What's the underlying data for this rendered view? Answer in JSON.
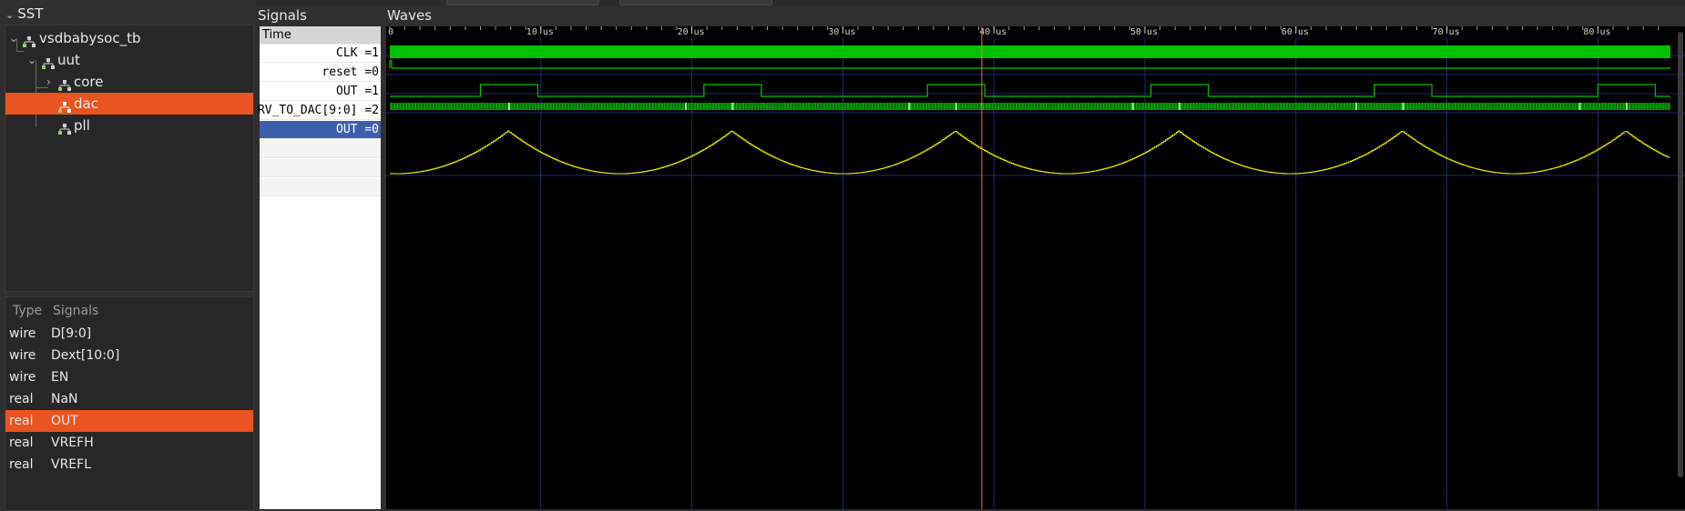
{
  "sst": {
    "title": "SST",
    "tree": [
      {
        "label": "vsdbabysoc_tb",
        "expanded": true,
        "depth": 0,
        "selected": false
      },
      {
        "label": "uut",
        "expanded": true,
        "depth": 1,
        "selected": false
      },
      {
        "label": "core",
        "expanded": false,
        "depth": 2,
        "selected": false
      },
      {
        "label": "dac",
        "expanded": null,
        "depth": 2,
        "selected": true
      },
      {
        "label": "pll",
        "expanded": null,
        "depth": 2,
        "selected": false
      }
    ]
  },
  "signal_list": {
    "header_type": "Type",
    "header_signals": "Signals",
    "rows": [
      {
        "type": "wire",
        "name": "D[9:0]",
        "selected": false
      },
      {
        "type": "wire",
        "name": "Dext[10:0]",
        "selected": false
      },
      {
        "type": "wire",
        "name": "EN",
        "selected": false
      },
      {
        "type": "real",
        "name": "NaN",
        "selected": false
      },
      {
        "type": "real",
        "name": "OUT",
        "selected": true
      },
      {
        "type": "real",
        "name": "VREFH",
        "selected": false
      },
      {
        "type": "real",
        "name": "VREFL",
        "selected": false
      }
    ]
  },
  "signals_pane": {
    "title": "Signals",
    "time_label": "Time",
    "rows": [
      {
        "label": "CLK =1",
        "selected": false
      },
      {
        "label": "reset =0",
        "selected": false
      },
      {
        "label": "OUT =1",
        "selected": false
      },
      {
        "label": "RV_TO_DAC[9:0] =2",
        "selected": false
      },
      {
        "label": "OUT =0",
        "selected": true
      }
    ]
  },
  "waves_pane": {
    "title": "Waves",
    "time_unit": "us",
    "axis_start_label": "0",
    "major_ticks_us": [
      10,
      20,
      30,
      40,
      50,
      60,
      70,
      80
    ],
    "visible_range_us": [
      0,
      84.8
    ],
    "cursor_time_us": 39.2,
    "out_digital_period_us": 14.8,
    "out_digital_high_us": 3.8,
    "out_digital_first_rise_us": 6.0,
    "out_analog_peak_us": 7.8,
    "out_analog_period_us": 14.8
  },
  "colors": {
    "accent_selection": "#e95420",
    "signal_selection": "#3d5fab",
    "wave_digital": "#00c000",
    "wave_analog": "#e6e600",
    "cursor": "#ff6a4d",
    "grid": "#1c2a6e"
  }
}
